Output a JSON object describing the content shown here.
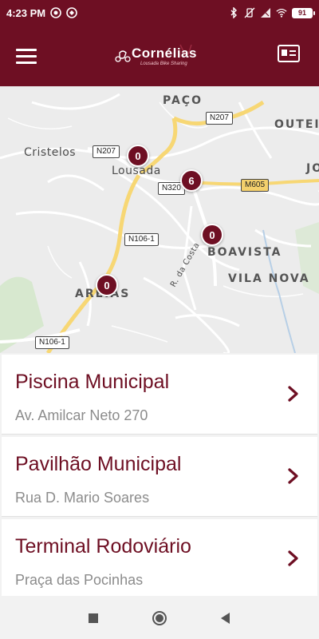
{
  "status_bar": {
    "time": "4:23 PM",
    "left_icons": [
      "circled-icon-1",
      "circled-icon-2"
    ],
    "right_icons": [
      "bluetooth-icon",
      "vibrate-icon",
      "signal-icon",
      "wifi-icon"
    ],
    "battery": "91"
  },
  "app_bar": {
    "logo_text": "Cornélias",
    "logo_subtitle": "Lousada Bike Sharing",
    "brand_color": "#6e0f23"
  },
  "map": {
    "labels": {
      "paco": "PAÇO",
      "outeiro": "OUTEI",
      "cristelos": "Cristelos",
      "lousada": "Lousada",
      "jo": "JO",
      "boavista": "BOAVISTA",
      "vila_nova": "VILA NOVA",
      "aveiros": "AREIAS",
      "rua_costa": "R. da Costa"
    },
    "road_shields": {
      "n207_top": "N207",
      "n207_left": "N207",
      "n320": "N320",
      "m605": "M605",
      "n106_1": "N106-1",
      "n106_1_bottom": "N106-1"
    },
    "clusters": [
      "0",
      "6",
      "0",
      "0"
    ]
  },
  "stations": [
    {
      "name": "Piscina Municipal",
      "address": "Av. Amilcar Neto 270"
    },
    {
      "name": "Pavilhão Municipal",
      "address": "Rua D. Mario Soares"
    },
    {
      "name": "Terminal Rodoviário",
      "address": "Praça das Pocinhas"
    }
  ],
  "nav_bar": {
    "icons": [
      "recent-apps-icon",
      "home-icon",
      "back-icon"
    ]
  }
}
